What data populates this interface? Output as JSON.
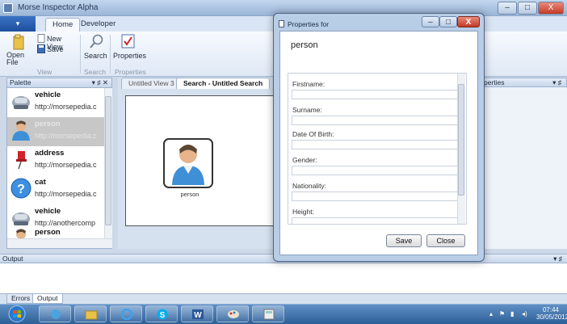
{
  "window": {
    "title": "Morse Inspector Alpha",
    "controls": [
      "–",
      "□",
      "X"
    ]
  },
  "ribbon": {
    "tabs": [
      "Home",
      "Developer"
    ],
    "buttons": {
      "open_file": "Open\nFile",
      "new_view": "New View",
      "save": "Save",
      "search": "Search",
      "properties": "Properties"
    },
    "groups": {
      "view": "View",
      "search": "Search",
      "properties": "Properties"
    }
  },
  "palette": {
    "title": "Palette",
    "header_icons": "▾ ♯ ✕",
    "items": [
      {
        "name": "vehicle",
        "url": "http://morsepedia.c",
        "icon": "car-icon",
        "selected": false
      },
      {
        "name": "person",
        "url": "http://morsepedia.c",
        "icon": "person-icon",
        "selected": true
      },
      {
        "name": "address",
        "url": "http://morsepedia.c",
        "icon": "pushpin-icon",
        "selected": false
      },
      {
        "name": "cat",
        "url": "http://morsepedia.c",
        "icon": "question-icon",
        "selected": false
      },
      {
        "name": "vehicle",
        "url": "http://anothercomp",
        "icon": "car-icon",
        "selected": false
      },
      {
        "name": "person",
        "url": "",
        "icon": "person-icon",
        "selected": false
      }
    ]
  },
  "documents": {
    "tabs": [
      "Untitled View 3",
      "Search - Untitled Search"
    ],
    "active_tab": "Search - Untitled Search",
    "node_label": "person"
  },
  "right_pane": {
    "title": "perties",
    "header_icons": "▾ ♯"
  },
  "output": {
    "title": "Output",
    "header_icons": "▾ ♯",
    "tabs": [
      "Errors",
      "Output"
    ]
  },
  "taskbar": {
    "time": "07:44",
    "date": "30/05/2012"
  },
  "dialog": {
    "title": "Properties for",
    "heading": "person",
    "fields": [
      {
        "label": "Firstname:",
        "value": ""
      },
      {
        "label": "Surname:",
        "value": ""
      },
      {
        "label": "Date Of Birth:",
        "value": ""
      },
      {
        "label": "Gender:",
        "value": ""
      },
      {
        "label": "Nationality:",
        "value": ""
      },
      {
        "label": "Height:",
        "value": ""
      }
    ],
    "save_label": "Save",
    "close_label": "Close"
  },
  "colors": {
    "accent": "#2d5f98",
    "selection": "#c7c7c7",
    "close": "#c23a24"
  }
}
